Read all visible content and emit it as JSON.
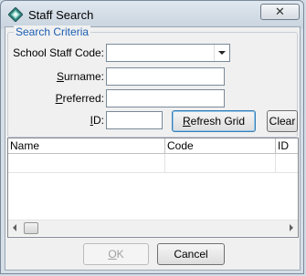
{
  "window": {
    "title": "Staff Search",
    "close_glyph": "✕"
  },
  "search": {
    "legend": "Search Criteria",
    "school_staff_code": {
      "label": "School Staff Code:",
      "value": ""
    },
    "surname": {
      "label_u": "S",
      "label_rest": "urname:",
      "value": ""
    },
    "preferred": {
      "label_u": "P",
      "label_rest": "referred:",
      "value": ""
    },
    "id": {
      "label_u": "I",
      "label_rest": "D:",
      "value": ""
    },
    "refresh_u": "R",
    "refresh_rest": "efresh Grid",
    "clear_label": "Clear"
  },
  "grid": {
    "columns": [
      "Name",
      "Code",
      "ID"
    ]
  },
  "footer": {
    "ok_u": "O",
    "ok_rest": "K",
    "cancel_label": "Cancel"
  }
}
